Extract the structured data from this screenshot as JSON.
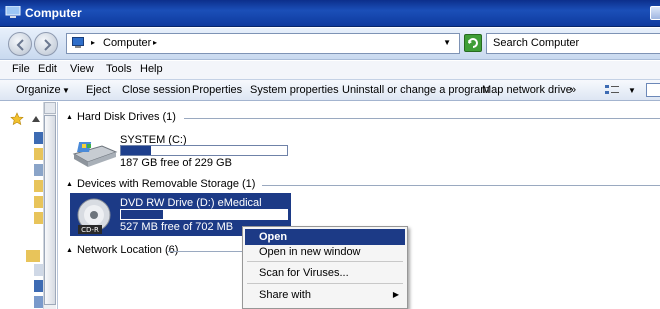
{
  "window": {
    "title": "Computer"
  },
  "address": {
    "location": "Computer",
    "search_placeholder": "Search Computer"
  },
  "menubar": {
    "items": [
      "File",
      "Edit",
      "View",
      "Tools",
      "Help"
    ]
  },
  "toolbar": {
    "items": [
      "Organize",
      "Eject",
      "Close session",
      "Properties",
      "System properties",
      "Uninstall or change a program",
      "Map network drive"
    ],
    "overflow": "»"
  },
  "groups": {
    "hard_disks": {
      "label": "Hard Disk Drives (1)"
    },
    "removable": {
      "label": "Devices with Removable Storage (1)"
    },
    "network": {
      "label": "Network Location (6)"
    }
  },
  "drives": {
    "system": {
      "name": "SYSTEM (C:)",
      "free": "187 GB free of 229 GB",
      "used_fraction": 0.18
    },
    "dvd": {
      "name": "DVD RW Drive (D:) eMedical",
      "free": "527 MB free of 702 MB",
      "used_fraction": 0.25,
      "badge": "CD-R"
    }
  },
  "context_menu": {
    "items": [
      "Open",
      "Open in new window",
      "Scan for Viruses...",
      "Share with"
    ]
  },
  "colors": {
    "selection": "#1c3a86",
    "titlebar": "#1b4fb8",
    "bar_fill": "#1e3f8c"
  }
}
